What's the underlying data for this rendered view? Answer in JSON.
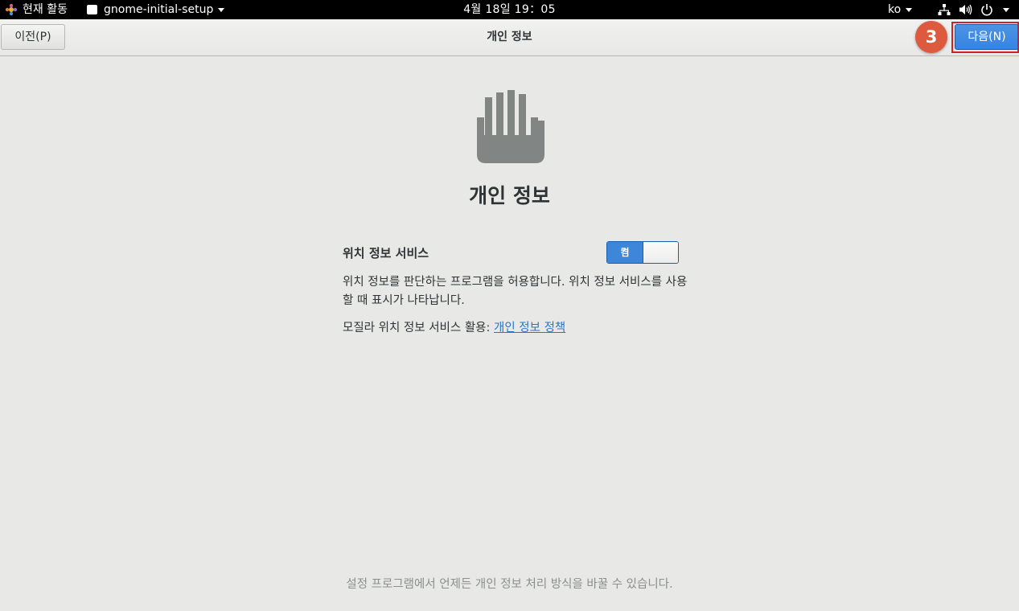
{
  "topbar": {
    "activities_label": "현재 활동",
    "app_menu_label": "gnome-initial-setup",
    "clock": "4월 18일  19：05",
    "language": "ko"
  },
  "header": {
    "title": "개인 정보",
    "back_label": "이전(P)",
    "next_label": "다음(N)"
  },
  "annotation": {
    "step_number": "3"
  },
  "privacy": {
    "heading": "개인 정보",
    "location_label": "위치 정보 서비스",
    "location_switch_state": "켬",
    "description": "위치 정보를 판단하는 프로그램을 허용합니다. 위치 정보 서비스를 사용할 때 표시가 나타납니다.",
    "policy_prefix": "모질라 위치 정보 서비스 활용: ",
    "policy_link": "개인 정보 정책",
    "footer_note": "설정 프로그램에서 언제든 개인 정보 처리 방식을 바꿀 수 있습니다."
  },
  "colors": {
    "accent": "#3584e4",
    "badge": "#dd5a3f",
    "highlight_border": "#d0202a",
    "background": "#e8e8e7"
  }
}
